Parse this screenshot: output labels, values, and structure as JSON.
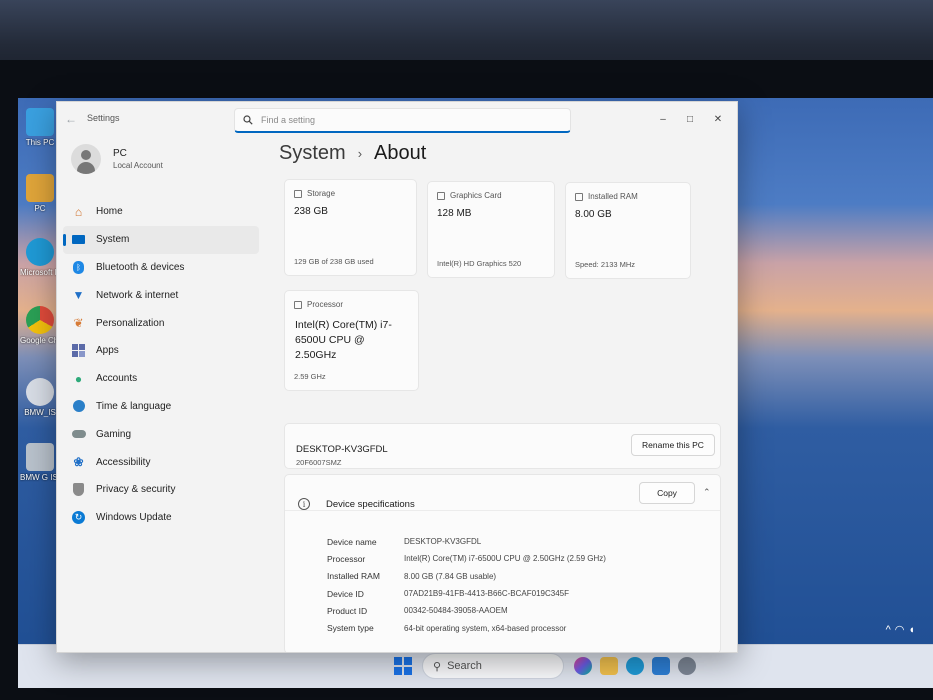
{
  "window": {
    "title": "Settings"
  },
  "search": {
    "placeholder": "Find a setting"
  },
  "account": {
    "name": "PC",
    "type": "Local Account"
  },
  "nav": [
    {
      "label": "Home",
      "icon": "home-icon",
      "color": "#d0722b"
    },
    {
      "label": "System",
      "icon": "display-icon",
      "color": "#0067c0",
      "active": true
    },
    {
      "label": "Bluetooth & devices",
      "icon": "bluetooth-icon",
      "color": "#1e88e5"
    },
    {
      "label": "Network & internet",
      "icon": "wifi-icon",
      "color": "#1f6fc7"
    },
    {
      "label": "Personalization",
      "icon": "brush-icon",
      "color": "#d77b36"
    },
    {
      "label": "Apps",
      "icon": "apps-icon",
      "color": "#5b6aa8"
    },
    {
      "label": "Accounts",
      "icon": "person-icon",
      "color": "#2eaa7a"
    },
    {
      "label": "Time & language",
      "icon": "globe-clock-icon",
      "color": "#2a7fc8"
    },
    {
      "label": "Gaming",
      "icon": "gamepad-icon",
      "color": "#7f8c8d"
    },
    {
      "label": "Accessibility",
      "icon": "accessibility-icon",
      "color": "#1f6fc7"
    },
    {
      "label": "Privacy & security",
      "icon": "shield-icon",
      "color": "#8a8a8a"
    },
    {
      "label": "Windows Update",
      "icon": "update-icon",
      "color": "#0a7ad4"
    }
  ],
  "breadcrumb": {
    "parent": "System",
    "separator": "›",
    "current": "About"
  },
  "cards": {
    "storage": {
      "label": "Storage",
      "value": "238 GB",
      "detail": "129 GB of 238 GB used"
    },
    "graphics": {
      "label": "Graphics Card",
      "value": "128 MB",
      "detail": "Intel(R) HD Graphics 520"
    },
    "ram": {
      "label": "Installed RAM",
      "value": "8.00 GB",
      "detail": "Speed: 2133 MHz"
    },
    "processor": {
      "label": "Processor",
      "value": "Intel(R) Core(TM) i7-6500U CPU @ 2.50GHz",
      "detail": "2.59 GHz"
    }
  },
  "device": {
    "name": "DESKTOP-KV3GFDL",
    "model": "20F6007SMZ",
    "rename_label": "Rename this PC"
  },
  "specs": {
    "title": "Device specifications",
    "copy_label": "Copy",
    "rows": [
      {
        "key": "Device name",
        "value": "DESKTOP-KV3GFDL"
      },
      {
        "key": "Processor",
        "value": "Intel(R) Core(TM) i7-6500U CPU @ 2.50GHz (2.59 GHz)"
      },
      {
        "key": "Installed RAM",
        "value": "8.00 GB (7.84 GB usable)"
      },
      {
        "key": "Device ID",
        "value": "07AD21B9-41FB-4413-B66C-BCAF019C345F"
      },
      {
        "key": "Product ID",
        "value": "00342-50484-39058-AAOEM"
      },
      {
        "key": "System type",
        "value": "64-bit operating system, x64-based processor"
      }
    ]
  },
  "desktop_icons": [
    {
      "label": "This PC",
      "color": "#3aa0e0"
    },
    {
      "label": "PC",
      "color": "#e0a53a"
    },
    {
      "label": "Microsoft Edge",
      "color": "#1f9ad6"
    },
    {
      "label": "Google Chrome",
      "color": "#e14b3b"
    },
    {
      "label": "BMW_IS",
      "color": "#d8dde6"
    },
    {
      "label": "BMW G ISTA",
      "color": "#b9c2cc"
    }
  ],
  "taskbar": {
    "search_label": "Search"
  }
}
